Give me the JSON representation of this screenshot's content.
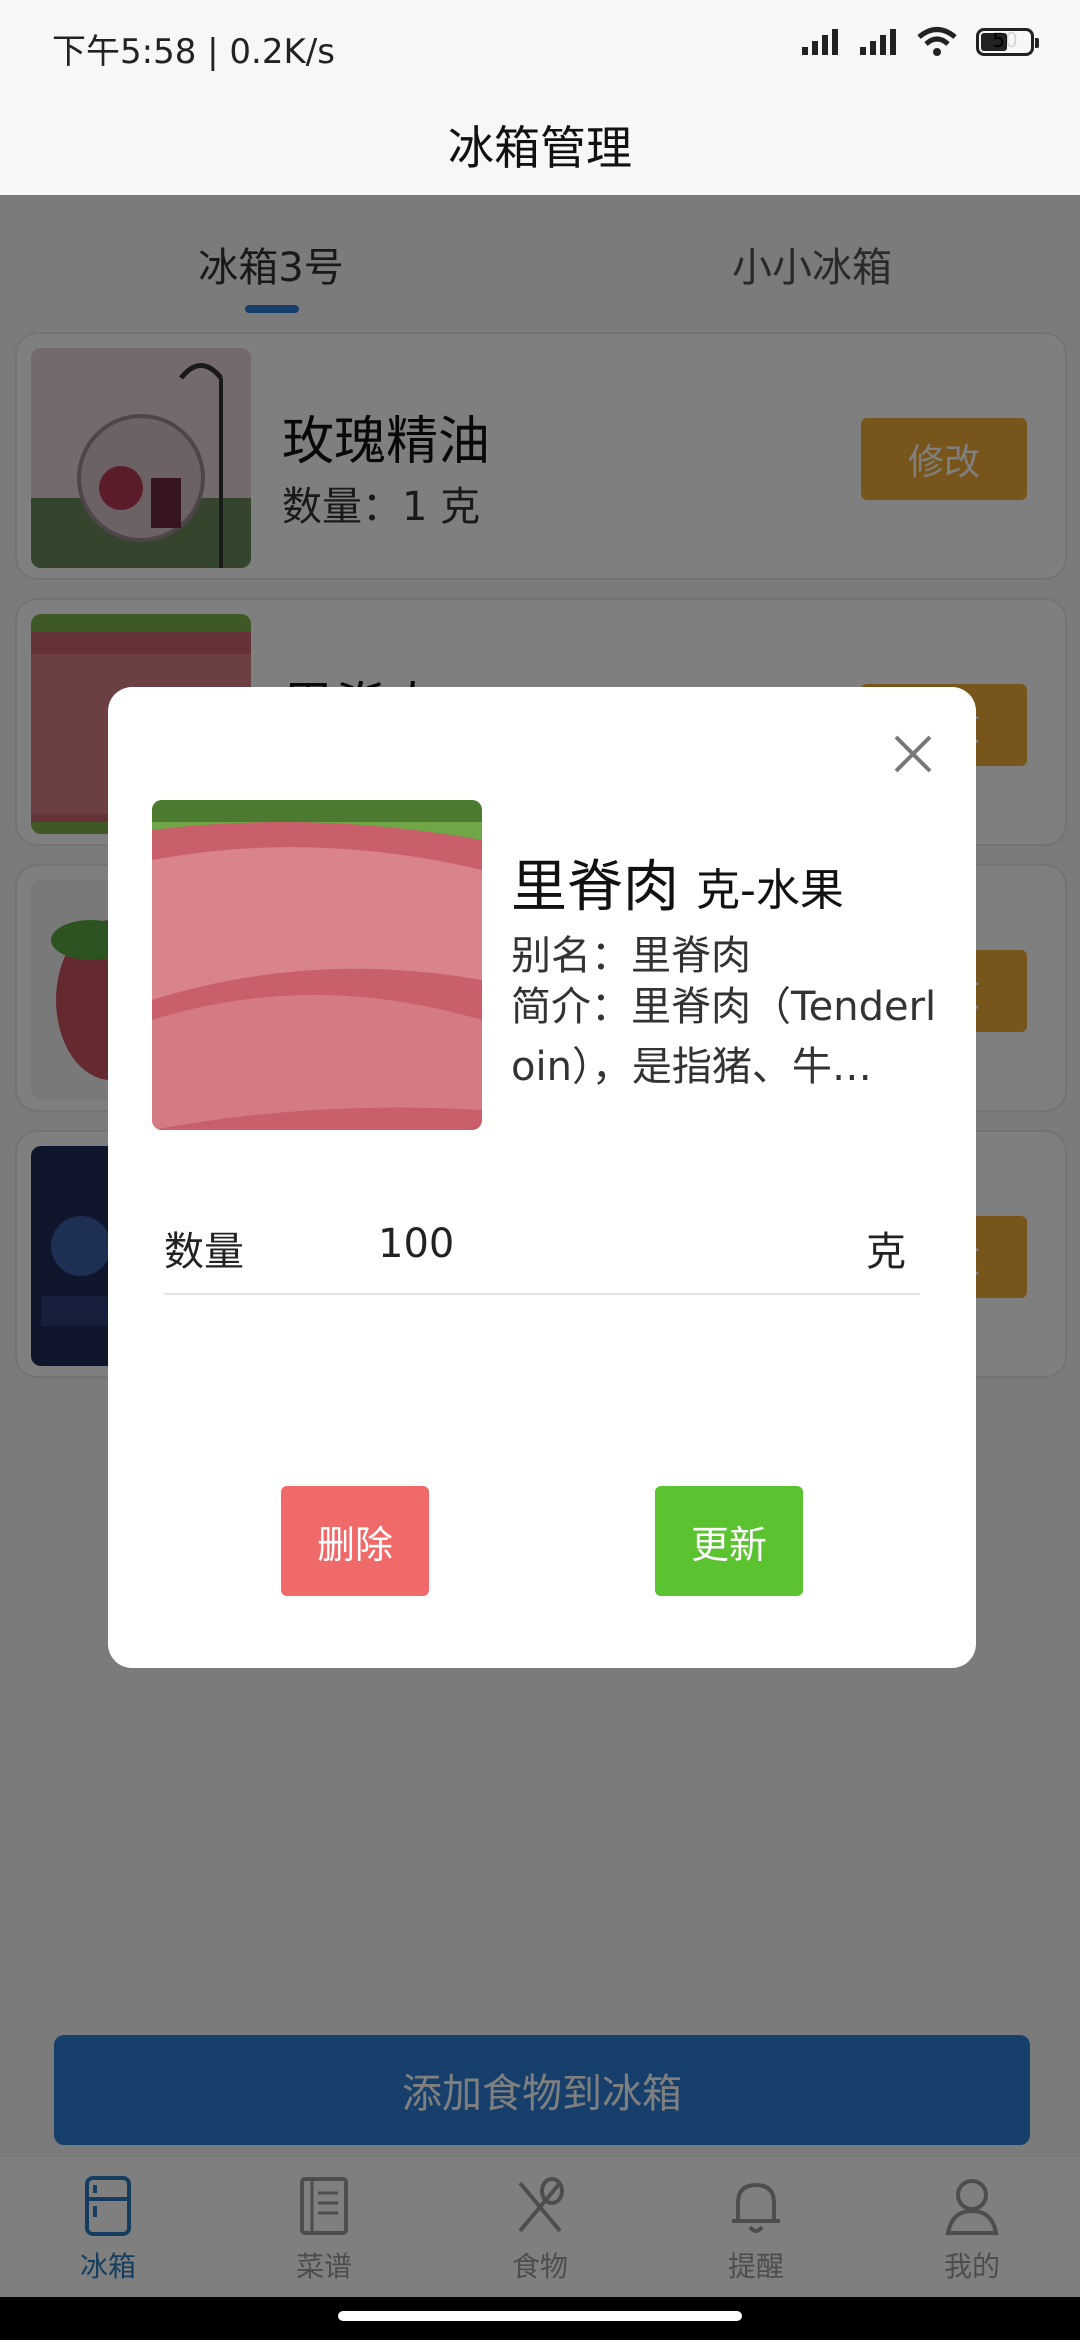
{
  "status": {
    "time_speed": "下午5:58 | 0.2K/s",
    "battery": "50",
    "icons": [
      "signal-icon",
      "signal-icon",
      "wifi-icon",
      "battery-icon"
    ]
  },
  "appbar": {
    "title": "冰箱管理"
  },
  "tabs": [
    {
      "label": "冰箱3号",
      "active": true
    },
    {
      "label": "小小冰箱",
      "active": false
    }
  ],
  "items": [
    {
      "name": "玫瑰精油",
      "qty_label": "数量：",
      "qty_value": "1 克",
      "edit_label": "修改"
    },
    {
      "name": "里脊肉",
      "edit_label": "修改"
    },
    {
      "name": "",
      "edit_label": "修改"
    },
    {
      "name": "",
      "edit_label": "修改"
    }
  ],
  "add_button": "添加食物到冰箱",
  "modal": {
    "name": "里脊肉",
    "category": "克-水果",
    "alias": "别名：里脊肉",
    "intro": "简介：里脊肉（Tenderloin），是指猪、牛…",
    "qty_label": "数量",
    "qty_value": "100",
    "qty_unit": "克",
    "delete_label": "删除",
    "update_label": "更新"
  },
  "nav": [
    {
      "label": "冰箱",
      "icon": "fridge-icon",
      "active": true
    },
    {
      "label": "菜谱",
      "icon": "recipe-book-icon",
      "active": false
    },
    {
      "label": "食物",
      "icon": "utensils-icon",
      "active": false
    },
    {
      "label": "提醒",
      "icon": "bell-icon",
      "active": false
    },
    {
      "label": "我的",
      "icon": "person-icon",
      "active": false
    }
  ],
  "colors": {
    "primary": "#2f7fd8",
    "edit": "#f0aa35",
    "delete": "#f06a6a",
    "update": "#5ac32f"
  }
}
